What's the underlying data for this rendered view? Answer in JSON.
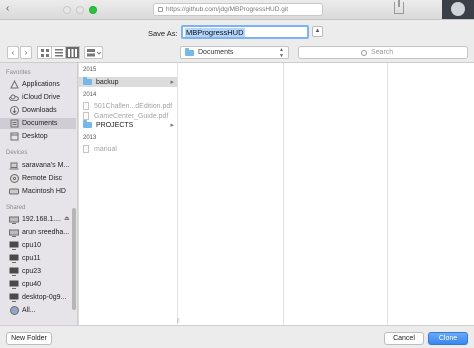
{
  "browser": {
    "url": "https://github.com/jdg/MBProgressHUD.git"
  },
  "dialog": {
    "save_as_label": "Save As:",
    "save_as_value": "MBProgressHUD",
    "location": "Documents",
    "search_placeholder": "Search"
  },
  "sidebar": {
    "favorites_header": "Favorites",
    "favorites": [
      {
        "label": "Applications",
        "icon": "applications-icon"
      },
      {
        "label": "iCloud Drive",
        "icon": "cloud-icon"
      },
      {
        "label": "Downloads",
        "icon": "downloads-icon"
      },
      {
        "label": "Documents",
        "icon": "documents-icon",
        "selected": true
      },
      {
        "label": "Desktop",
        "icon": "desktop-icon"
      }
    ],
    "devices_header": "Devices",
    "devices": [
      {
        "label": "saravana's M...",
        "icon": "laptop-icon"
      },
      {
        "label": "Remote Disc",
        "icon": "disc-icon"
      },
      {
        "label": "Macintosh HD",
        "icon": "hard-drive-icon"
      }
    ],
    "shared_header": "Shared",
    "shared": [
      {
        "label": "192.168.1....",
        "icon": "server-icon",
        "eject": true
      },
      {
        "label": "arun sreedha...",
        "icon": "server-icon"
      },
      {
        "label": "cpu10",
        "icon": "monitor-icon"
      },
      {
        "label": "cpu11",
        "icon": "monitor-icon"
      },
      {
        "label": "cpu23",
        "icon": "monitor-icon"
      },
      {
        "label": "cpu40",
        "icon": "monitor-icon"
      },
      {
        "label": "desktop-0g9...",
        "icon": "monitor-icon"
      },
      {
        "label": "All...",
        "icon": "network-icon"
      }
    ]
  },
  "browser_column": {
    "groups": [
      {
        "year": "2015",
        "items": [
          {
            "label": "backup",
            "type": "folder",
            "selected": true,
            "dim": false,
            "chevron": true
          }
        ]
      },
      {
        "year": "2014",
        "items": [
          {
            "label": "501Challen...dEdition.pdf",
            "type": "file",
            "dim": true
          },
          {
            "label": "GameCenter_Guide.pdf",
            "type": "file",
            "dim": true
          },
          {
            "label": "PROJECTS",
            "type": "folder",
            "dim": false,
            "chevron": true
          }
        ]
      },
      {
        "year": "2013",
        "items": [
          {
            "label": "manual",
            "type": "file",
            "dim": true
          }
        ]
      }
    ]
  },
  "footer": {
    "new_folder": "New Folder",
    "cancel": "Cancel",
    "clone": "Clone"
  },
  "colors": {
    "accent": "#3a86f0",
    "folder": "#74b7ea",
    "selection": "#cfcdd3"
  }
}
